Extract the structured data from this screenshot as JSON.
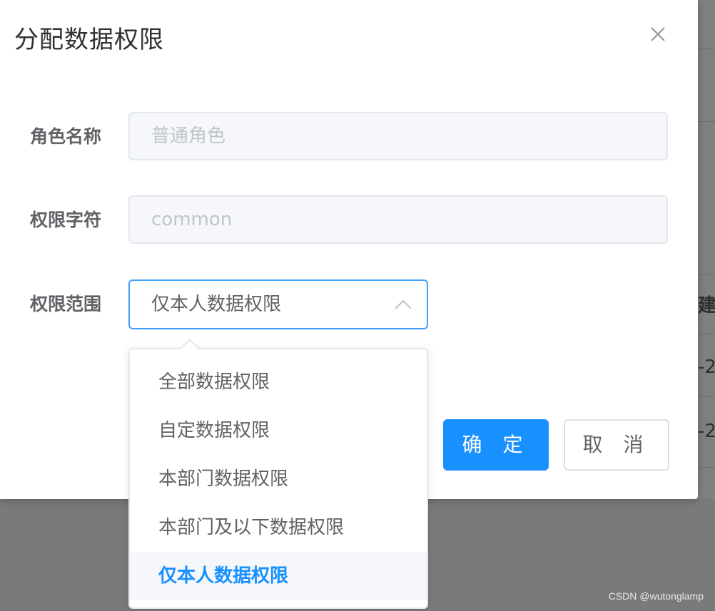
{
  "background": {
    "partial_texts": [
      "建",
      "-2",
      "-2"
    ]
  },
  "dialog": {
    "title": "分配数据权限",
    "close_icon": "close-icon",
    "fields": {
      "role_name": {
        "label": "角色名称",
        "value": "普通角色"
      },
      "role_key": {
        "label": "权限字符",
        "value": "common"
      },
      "data_scope": {
        "label": "权限范围",
        "value": "仅本人数据权限"
      }
    },
    "dropdown": {
      "options": [
        "全部数据权限",
        "自定数据权限",
        "本部门数据权限",
        "本部门及以下数据权限",
        "仅本人数据权限"
      ],
      "selected": "仅本人数据权限"
    },
    "buttons": {
      "confirm": "确 定",
      "cancel": "取 消"
    }
  },
  "watermark": "CSDN @wutonglamp",
  "colors": {
    "primary": "#1890ff",
    "focus_border": "#409eff",
    "text": "#606266",
    "placeholder": "#c0c4cc"
  }
}
